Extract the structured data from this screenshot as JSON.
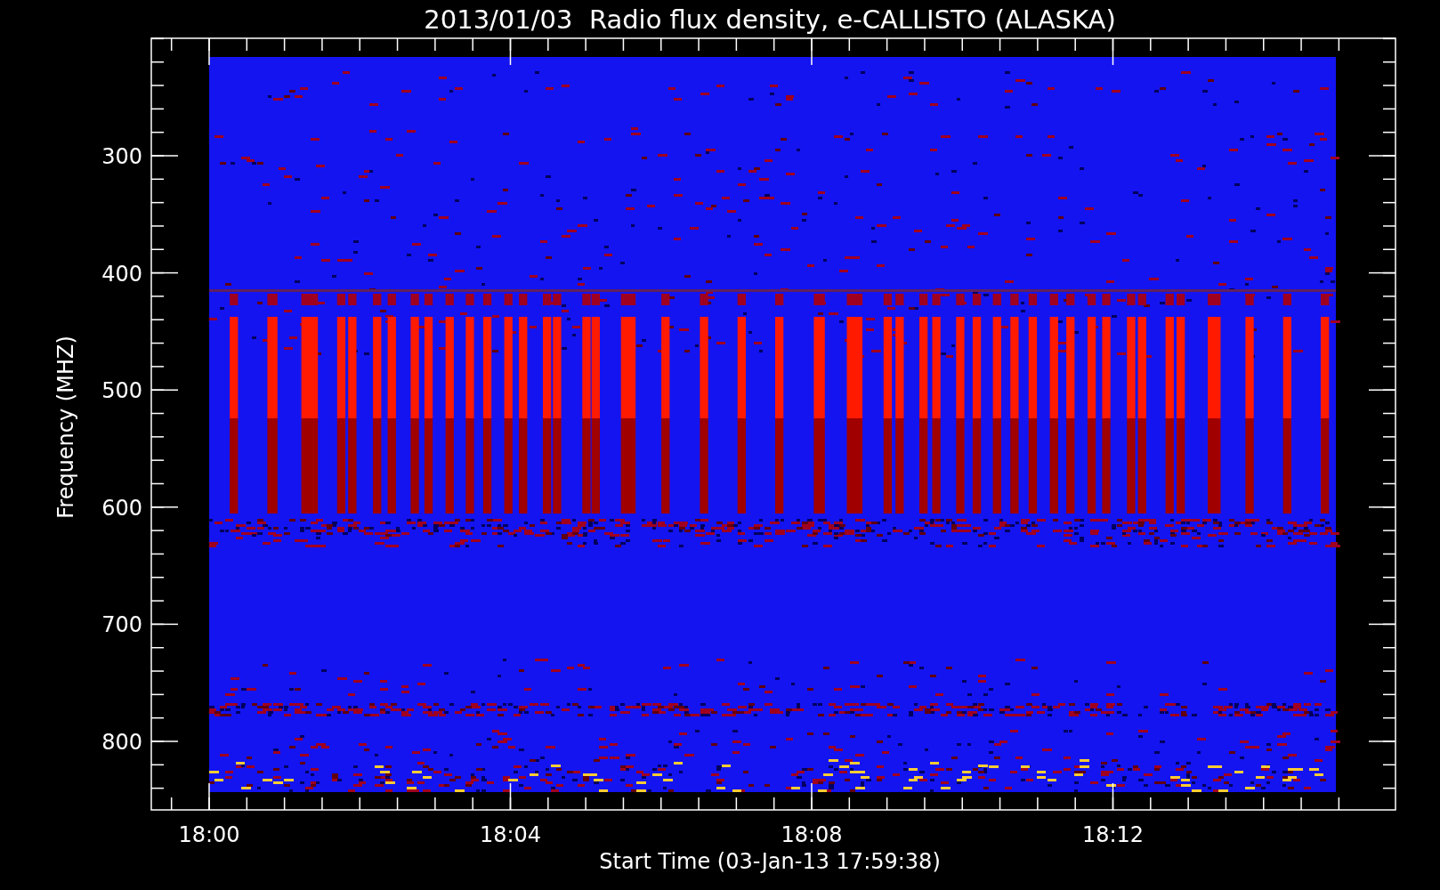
{
  "title": "2013/01/03  Radio flux density, e-CALLISTO (ALASKA)",
  "ylabel": "Frequency (MHZ)",
  "xlabel": "Start Time (03-Jan-13 17:59:38)",
  "yticks": [
    "300",
    "400",
    "500",
    "600",
    "700",
    "800"
  ],
  "xticks": [
    "18:00",
    "18:04",
    "18:08",
    "18:12"
  ]
}
